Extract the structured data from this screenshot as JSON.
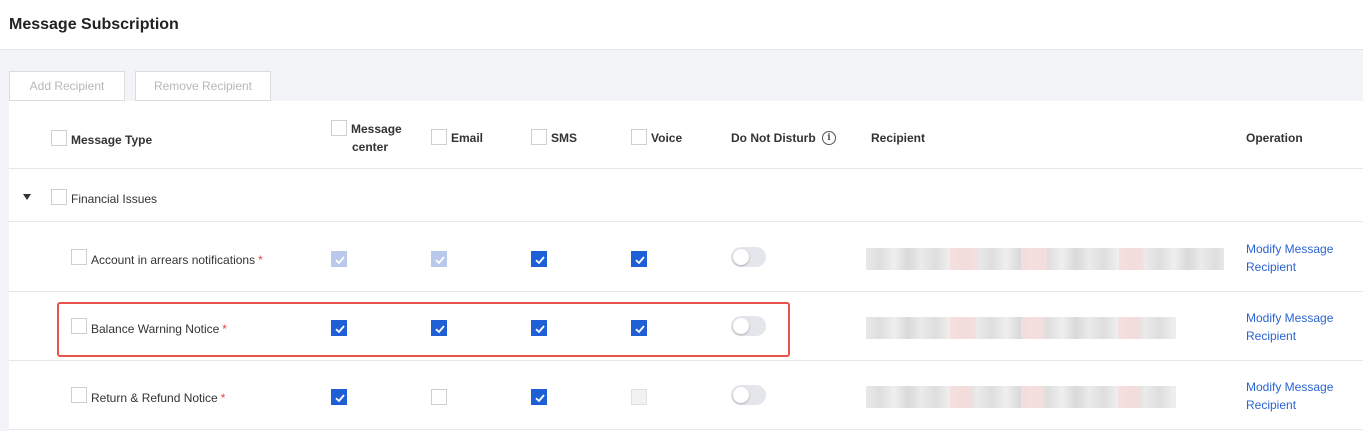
{
  "header": {
    "title": "Message Subscription"
  },
  "toolbar": {
    "add_label": "Add Recipient",
    "remove_label": "Remove Recipient"
  },
  "table": {
    "columns": {
      "message_type": "Message Type",
      "message_center_line1": "Message",
      "message_center_line2": "center",
      "email": "Email",
      "sms": "SMS",
      "voice": "Voice",
      "do_not_disturb": "Do Not Disturb",
      "recipient": "Recipient",
      "operation": "Operation"
    },
    "group": {
      "label": "Financial Issues",
      "expanded": true
    },
    "rows": [
      {
        "name": "Account in arrears notifications",
        "required_mark": "*",
        "message_center": "checked-disabled",
        "email": "checked-disabled",
        "sms": "checked",
        "voice": "checked",
        "do_not_disturb": false,
        "action_line1": "Modify Message",
        "action_line2": "Recipient"
      },
      {
        "name": "Balance Warning Notice",
        "required_mark": "*",
        "message_center": "checked",
        "email": "checked",
        "sms": "checked",
        "voice": "checked",
        "do_not_disturb": false,
        "highlighted": true,
        "action_line1": "Modify Message",
        "action_line2": "Recipient"
      },
      {
        "name": "Return & Refund Notice",
        "required_mark": "*",
        "message_center": "checked",
        "email": "unchecked",
        "sms": "checked",
        "voice": "disabled",
        "do_not_disturb": false,
        "action_line1": "Modify Message",
        "action_line2": "Recipient"
      }
    ]
  },
  "colors": {
    "primary": "#1f5fd6",
    "link": "#2a63d4",
    "required": "#e54545",
    "highlight": "#e5534b"
  },
  "icons": {
    "info": "info-circle-icon",
    "expand": "caret-down-icon",
    "check": "checkmark-icon"
  },
  "info_glyph": "i"
}
